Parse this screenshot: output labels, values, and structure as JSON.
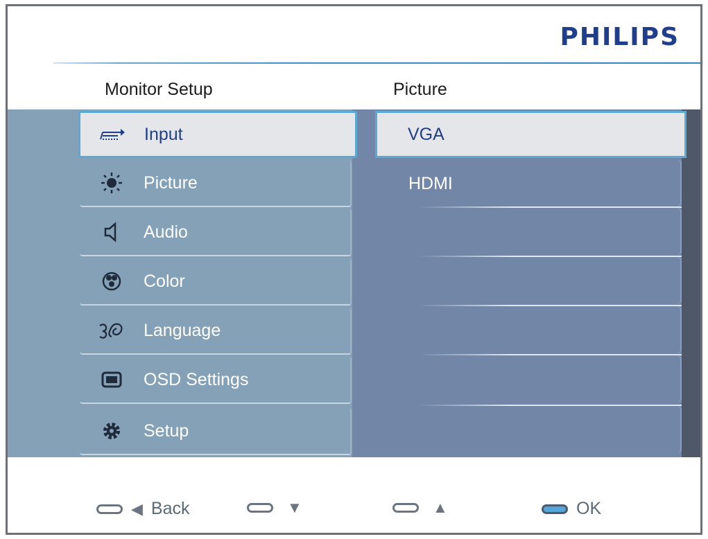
{
  "brand": "PHILIPS",
  "headers": {
    "left": "Monitor Setup",
    "right": "Picture"
  },
  "menu": {
    "items": [
      {
        "label": "Input",
        "icon": "input-icon",
        "selected": true
      },
      {
        "label": "Picture",
        "icon": "brightness-icon",
        "selected": false
      },
      {
        "label": "Audio",
        "icon": "speaker-icon",
        "selected": false
      },
      {
        "label": "Color",
        "icon": "color-palette-icon",
        "selected": false
      },
      {
        "label": "Language",
        "icon": "language-icon",
        "selected": false
      },
      {
        "label": "OSD Settings",
        "icon": "osd-settings-icon",
        "selected": false
      },
      {
        "label": "Setup",
        "icon": "gear-icon",
        "selected": false
      }
    ]
  },
  "submenu": {
    "items": [
      {
        "label": "VGA",
        "selected": true
      },
      {
        "label": "HDMI",
        "selected": false
      }
    ]
  },
  "footer": {
    "back_label": "Back",
    "ok_label": "OK"
  },
  "colors": {
    "brand": "#1f3e8c",
    "selection_border": "#5aaad6",
    "menu_bg": "#84a1b8",
    "submenu_bg": "#7287a8"
  }
}
